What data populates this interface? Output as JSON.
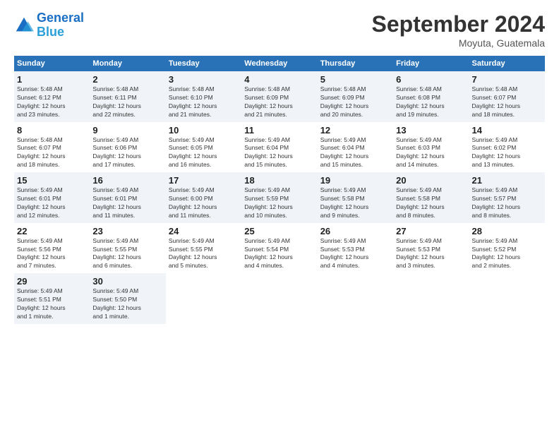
{
  "header": {
    "logo_line1": "General",
    "logo_line2": "Blue",
    "month": "September 2024",
    "location": "Moyuta, Guatemala"
  },
  "weekdays": [
    "Sunday",
    "Monday",
    "Tuesday",
    "Wednesday",
    "Thursday",
    "Friday",
    "Saturday"
  ],
  "weeks": [
    [
      {
        "day": "1",
        "info": "Sunrise: 5:48 AM\nSunset: 6:12 PM\nDaylight: 12 hours\nand 23 minutes."
      },
      {
        "day": "2",
        "info": "Sunrise: 5:48 AM\nSunset: 6:11 PM\nDaylight: 12 hours\nand 22 minutes."
      },
      {
        "day": "3",
        "info": "Sunrise: 5:48 AM\nSunset: 6:10 PM\nDaylight: 12 hours\nand 21 minutes."
      },
      {
        "day": "4",
        "info": "Sunrise: 5:48 AM\nSunset: 6:09 PM\nDaylight: 12 hours\nand 21 minutes."
      },
      {
        "day": "5",
        "info": "Sunrise: 5:48 AM\nSunset: 6:09 PM\nDaylight: 12 hours\nand 20 minutes."
      },
      {
        "day": "6",
        "info": "Sunrise: 5:48 AM\nSunset: 6:08 PM\nDaylight: 12 hours\nand 19 minutes."
      },
      {
        "day": "7",
        "info": "Sunrise: 5:48 AM\nSunset: 6:07 PM\nDaylight: 12 hours\nand 18 minutes."
      }
    ],
    [
      {
        "day": "8",
        "info": "Sunrise: 5:48 AM\nSunset: 6:07 PM\nDaylight: 12 hours\nand 18 minutes."
      },
      {
        "day": "9",
        "info": "Sunrise: 5:49 AM\nSunset: 6:06 PM\nDaylight: 12 hours\nand 17 minutes."
      },
      {
        "day": "10",
        "info": "Sunrise: 5:49 AM\nSunset: 6:05 PM\nDaylight: 12 hours\nand 16 minutes."
      },
      {
        "day": "11",
        "info": "Sunrise: 5:49 AM\nSunset: 6:04 PM\nDaylight: 12 hours\nand 15 minutes."
      },
      {
        "day": "12",
        "info": "Sunrise: 5:49 AM\nSunset: 6:04 PM\nDaylight: 12 hours\nand 15 minutes."
      },
      {
        "day": "13",
        "info": "Sunrise: 5:49 AM\nSunset: 6:03 PM\nDaylight: 12 hours\nand 14 minutes."
      },
      {
        "day": "14",
        "info": "Sunrise: 5:49 AM\nSunset: 6:02 PM\nDaylight: 12 hours\nand 13 minutes."
      }
    ],
    [
      {
        "day": "15",
        "info": "Sunrise: 5:49 AM\nSunset: 6:01 PM\nDaylight: 12 hours\nand 12 minutes."
      },
      {
        "day": "16",
        "info": "Sunrise: 5:49 AM\nSunset: 6:01 PM\nDaylight: 12 hours\nand 11 minutes."
      },
      {
        "day": "17",
        "info": "Sunrise: 5:49 AM\nSunset: 6:00 PM\nDaylight: 12 hours\nand 11 minutes."
      },
      {
        "day": "18",
        "info": "Sunrise: 5:49 AM\nSunset: 5:59 PM\nDaylight: 12 hours\nand 10 minutes."
      },
      {
        "day": "19",
        "info": "Sunrise: 5:49 AM\nSunset: 5:58 PM\nDaylight: 12 hours\nand 9 minutes."
      },
      {
        "day": "20",
        "info": "Sunrise: 5:49 AM\nSunset: 5:58 PM\nDaylight: 12 hours\nand 8 minutes."
      },
      {
        "day": "21",
        "info": "Sunrise: 5:49 AM\nSunset: 5:57 PM\nDaylight: 12 hours\nand 8 minutes."
      }
    ],
    [
      {
        "day": "22",
        "info": "Sunrise: 5:49 AM\nSunset: 5:56 PM\nDaylight: 12 hours\nand 7 minutes."
      },
      {
        "day": "23",
        "info": "Sunrise: 5:49 AM\nSunset: 5:55 PM\nDaylight: 12 hours\nand 6 minutes."
      },
      {
        "day": "24",
        "info": "Sunrise: 5:49 AM\nSunset: 5:55 PM\nDaylight: 12 hours\nand 5 minutes."
      },
      {
        "day": "25",
        "info": "Sunrise: 5:49 AM\nSunset: 5:54 PM\nDaylight: 12 hours\nand 4 minutes."
      },
      {
        "day": "26",
        "info": "Sunrise: 5:49 AM\nSunset: 5:53 PM\nDaylight: 12 hours\nand 4 minutes."
      },
      {
        "day": "27",
        "info": "Sunrise: 5:49 AM\nSunset: 5:53 PM\nDaylight: 12 hours\nand 3 minutes."
      },
      {
        "day": "28",
        "info": "Sunrise: 5:49 AM\nSunset: 5:52 PM\nDaylight: 12 hours\nand 2 minutes."
      }
    ],
    [
      {
        "day": "29",
        "info": "Sunrise: 5:49 AM\nSunset: 5:51 PM\nDaylight: 12 hours\nand 1 minute."
      },
      {
        "day": "30",
        "info": "Sunrise: 5:49 AM\nSunset: 5:50 PM\nDaylight: 12 hours\nand 1 minute."
      },
      null,
      null,
      null,
      null,
      null
    ]
  ]
}
